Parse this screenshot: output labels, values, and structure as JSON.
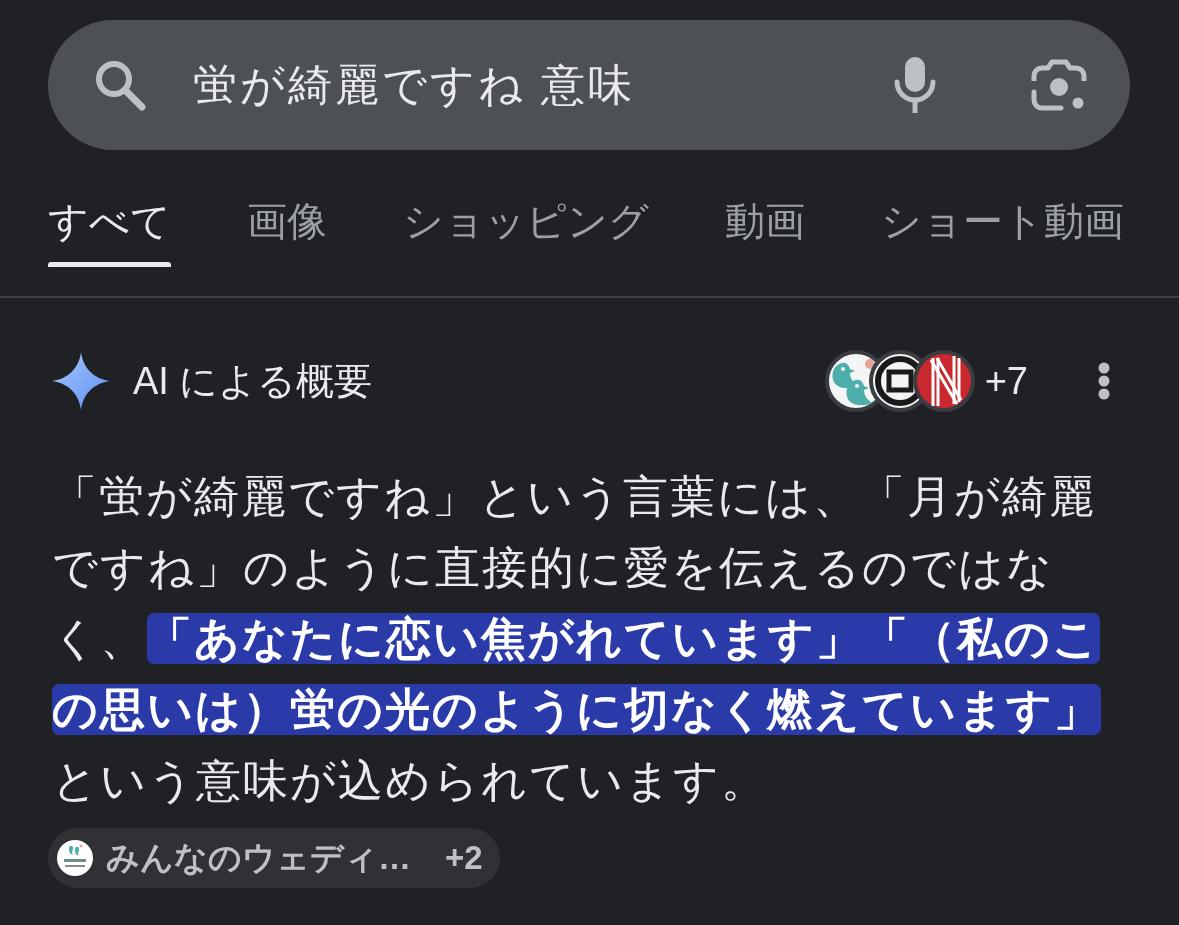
{
  "search": {
    "query": "蛍が綺麗ですね 意味"
  },
  "tabs": [
    {
      "label": "すべて",
      "selected": true
    },
    {
      "label": "画像",
      "selected": false
    },
    {
      "label": "ショッピング",
      "selected": false
    },
    {
      "label": "動画",
      "selected": false
    },
    {
      "label": "ショート動画",
      "selected": false
    }
  ],
  "ai_overview": {
    "title": "AI による概要",
    "sources_more": "+7",
    "summary": "「蛍が綺麗ですね」という言葉には、「月が綺麗ですね」のように直接的に愛を伝えるのではなく、**「あなたに恋い焦がれています」「（私のこの思いは）蛍の光のように切なく燃えています」**という意味が込められています。",
    "source_chip": {
      "label": "みんなのウェディ…",
      "more": "+2"
    }
  }
}
